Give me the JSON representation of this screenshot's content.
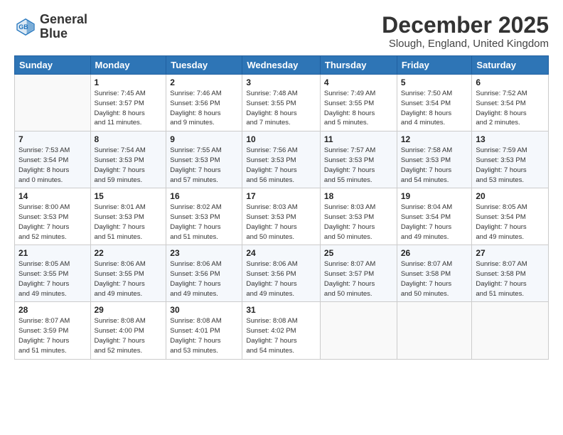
{
  "header": {
    "logo_line1": "General",
    "logo_line2": "Blue",
    "month_year": "December 2025",
    "location": "Slough, England, United Kingdom"
  },
  "days_of_week": [
    "Sunday",
    "Monday",
    "Tuesday",
    "Wednesday",
    "Thursday",
    "Friday",
    "Saturday"
  ],
  "weeks": [
    [
      {
        "day": "",
        "info": ""
      },
      {
        "day": "1",
        "info": "Sunrise: 7:45 AM\nSunset: 3:57 PM\nDaylight: 8 hours\nand 11 minutes."
      },
      {
        "day": "2",
        "info": "Sunrise: 7:46 AM\nSunset: 3:56 PM\nDaylight: 8 hours\nand 9 minutes."
      },
      {
        "day": "3",
        "info": "Sunrise: 7:48 AM\nSunset: 3:55 PM\nDaylight: 8 hours\nand 7 minutes."
      },
      {
        "day": "4",
        "info": "Sunrise: 7:49 AM\nSunset: 3:55 PM\nDaylight: 8 hours\nand 5 minutes."
      },
      {
        "day": "5",
        "info": "Sunrise: 7:50 AM\nSunset: 3:54 PM\nDaylight: 8 hours\nand 4 minutes."
      },
      {
        "day": "6",
        "info": "Sunrise: 7:52 AM\nSunset: 3:54 PM\nDaylight: 8 hours\nand 2 minutes."
      }
    ],
    [
      {
        "day": "7",
        "info": "Sunrise: 7:53 AM\nSunset: 3:54 PM\nDaylight: 8 hours\nand 0 minutes."
      },
      {
        "day": "8",
        "info": "Sunrise: 7:54 AM\nSunset: 3:53 PM\nDaylight: 7 hours\nand 59 minutes."
      },
      {
        "day": "9",
        "info": "Sunrise: 7:55 AM\nSunset: 3:53 PM\nDaylight: 7 hours\nand 57 minutes."
      },
      {
        "day": "10",
        "info": "Sunrise: 7:56 AM\nSunset: 3:53 PM\nDaylight: 7 hours\nand 56 minutes."
      },
      {
        "day": "11",
        "info": "Sunrise: 7:57 AM\nSunset: 3:53 PM\nDaylight: 7 hours\nand 55 minutes."
      },
      {
        "day": "12",
        "info": "Sunrise: 7:58 AM\nSunset: 3:53 PM\nDaylight: 7 hours\nand 54 minutes."
      },
      {
        "day": "13",
        "info": "Sunrise: 7:59 AM\nSunset: 3:53 PM\nDaylight: 7 hours\nand 53 minutes."
      }
    ],
    [
      {
        "day": "14",
        "info": "Sunrise: 8:00 AM\nSunset: 3:53 PM\nDaylight: 7 hours\nand 52 minutes."
      },
      {
        "day": "15",
        "info": "Sunrise: 8:01 AM\nSunset: 3:53 PM\nDaylight: 7 hours\nand 51 minutes."
      },
      {
        "day": "16",
        "info": "Sunrise: 8:02 AM\nSunset: 3:53 PM\nDaylight: 7 hours\nand 51 minutes."
      },
      {
        "day": "17",
        "info": "Sunrise: 8:03 AM\nSunset: 3:53 PM\nDaylight: 7 hours\nand 50 minutes."
      },
      {
        "day": "18",
        "info": "Sunrise: 8:03 AM\nSunset: 3:53 PM\nDaylight: 7 hours\nand 50 minutes."
      },
      {
        "day": "19",
        "info": "Sunrise: 8:04 AM\nSunset: 3:54 PM\nDaylight: 7 hours\nand 49 minutes."
      },
      {
        "day": "20",
        "info": "Sunrise: 8:05 AM\nSunset: 3:54 PM\nDaylight: 7 hours\nand 49 minutes."
      }
    ],
    [
      {
        "day": "21",
        "info": "Sunrise: 8:05 AM\nSunset: 3:55 PM\nDaylight: 7 hours\nand 49 minutes."
      },
      {
        "day": "22",
        "info": "Sunrise: 8:06 AM\nSunset: 3:55 PM\nDaylight: 7 hours\nand 49 minutes."
      },
      {
        "day": "23",
        "info": "Sunrise: 8:06 AM\nSunset: 3:56 PM\nDaylight: 7 hours\nand 49 minutes."
      },
      {
        "day": "24",
        "info": "Sunrise: 8:06 AM\nSunset: 3:56 PM\nDaylight: 7 hours\nand 49 minutes."
      },
      {
        "day": "25",
        "info": "Sunrise: 8:07 AM\nSunset: 3:57 PM\nDaylight: 7 hours\nand 50 minutes."
      },
      {
        "day": "26",
        "info": "Sunrise: 8:07 AM\nSunset: 3:58 PM\nDaylight: 7 hours\nand 50 minutes."
      },
      {
        "day": "27",
        "info": "Sunrise: 8:07 AM\nSunset: 3:58 PM\nDaylight: 7 hours\nand 51 minutes."
      }
    ],
    [
      {
        "day": "28",
        "info": "Sunrise: 8:07 AM\nSunset: 3:59 PM\nDaylight: 7 hours\nand 51 minutes."
      },
      {
        "day": "29",
        "info": "Sunrise: 8:08 AM\nSunset: 4:00 PM\nDaylight: 7 hours\nand 52 minutes."
      },
      {
        "day": "30",
        "info": "Sunrise: 8:08 AM\nSunset: 4:01 PM\nDaylight: 7 hours\nand 53 minutes."
      },
      {
        "day": "31",
        "info": "Sunrise: 8:08 AM\nSunset: 4:02 PM\nDaylight: 7 hours\nand 54 minutes."
      },
      {
        "day": "",
        "info": ""
      },
      {
        "day": "",
        "info": ""
      },
      {
        "day": "",
        "info": ""
      }
    ]
  ]
}
